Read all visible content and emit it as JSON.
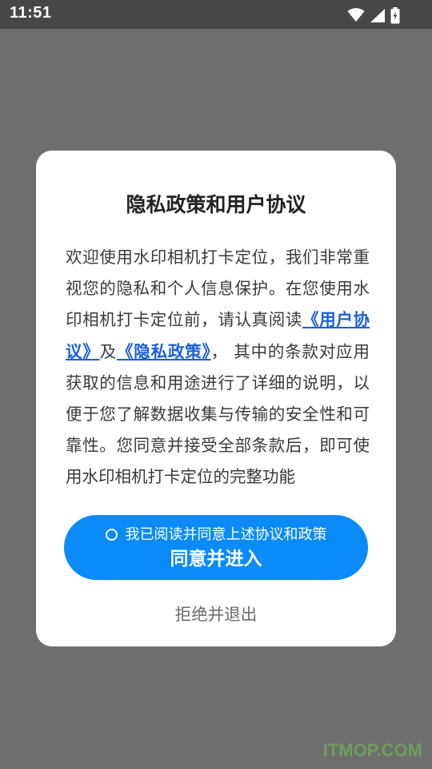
{
  "status_bar": {
    "time": "11:51",
    "icons": [
      "wifi-icon",
      "signal-icon",
      "battery-charging-icon"
    ]
  },
  "dialog": {
    "title": "隐私政策和用户协议",
    "body_intro": "欢迎使用水印相机打卡定位，我们非常重视您的隐私和个人信息保护。在您使用水印相机打卡定位前，请认真阅读",
    "link_user_agreement": "《用户协议》",
    "conjunction": "及",
    "link_privacy_policy": "《隐私政策》",
    "body_rest": "， 其中的条款对应用获取的信息和用途进行了详细的说明，以便于您了解数据收集与传输的安全性和可靠性。您同意并接受全部条款后，即可使用水印相机打卡定位的完整功能",
    "checkbox_label": "我已阅读并同意上述协议和政策",
    "agree_button_label": "同意并进入",
    "reject_button_label": "拒绝并退出"
  },
  "watermark": "ITMOP.COM",
  "colors": {
    "overlay": "#6e6e6e",
    "status_bar": "#474747",
    "accent_button": "#0a8bf8",
    "link": "#1a5fd8"
  }
}
